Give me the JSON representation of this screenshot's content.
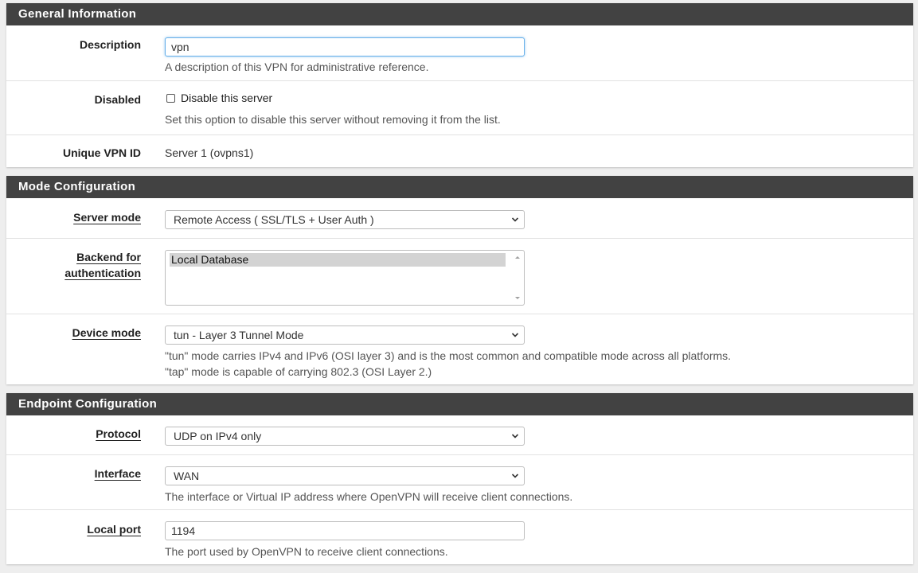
{
  "general": {
    "title": "General Information",
    "description": {
      "label": "Description",
      "value": "vpn",
      "help": "A description of this VPN for administrative reference."
    },
    "disabled": {
      "label": "Disabled",
      "checkbox_label": "Disable this server",
      "checked": false,
      "help": "Set this option to disable this server without removing it from the list."
    },
    "unique_id": {
      "label": "Unique VPN ID",
      "value": "Server 1 (ovpns1)"
    }
  },
  "mode": {
    "title": "Mode Configuration",
    "server_mode": {
      "label": "Server mode",
      "value": "Remote Access ( SSL/TLS + User Auth )"
    },
    "backend": {
      "label_line1": "Backend for",
      "label_line2": "authentication",
      "options": [
        "Local Database"
      ],
      "selected": "Local Database"
    },
    "device_mode": {
      "label": "Device mode",
      "value": "tun - Layer 3 Tunnel Mode",
      "help_line1": "\"tun\" mode carries IPv4 and IPv6 (OSI layer 3) and is the most common and compatible mode across all platforms.",
      "help_line2": "\"tap\" mode is capable of carrying 802.3 (OSI Layer 2.)"
    }
  },
  "endpoint": {
    "title": "Endpoint Configuration",
    "protocol": {
      "label": "Protocol",
      "value": "UDP on IPv4 only"
    },
    "interface": {
      "label": "Interface",
      "value": "WAN",
      "help": "The interface or Virtual IP address where OpenVPN will receive client connections."
    },
    "local_port": {
      "label": "Local port",
      "value": "1194",
      "help": "The port used by OpenVPN to receive client connections."
    }
  },
  "icons": {
    "select_arrow": "chevron-down-icon",
    "listbox_scroll_up": "scroll-up-arrow-icon",
    "listbox_scroll_down": "scroll-down-arrow-icon"
  },
  "colors": {
    "panel_header": "#424242",
    "background": "#eeeeee",
    "focus_border": "#66afe9"
  }
}
